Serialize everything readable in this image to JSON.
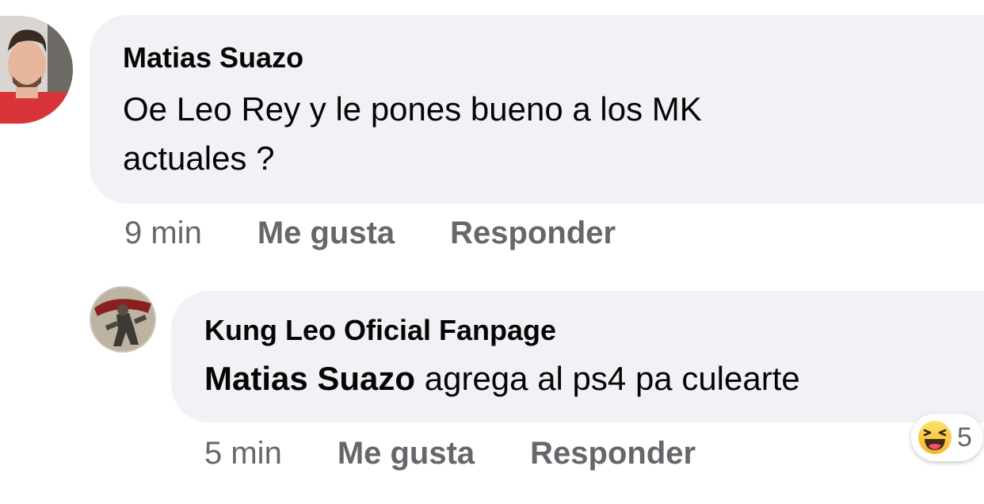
{
  "comments": [
    {
      "author": "Matias Suazo",
      "text_line1": "Oe Leo Rey y le pones bueno a los MK",
      "text_line2": "actuales ?",
      "time": "9 min",
      "like_label": "Me gusta",
      "reply_label": "Responder"
    },
    {
      "author": "Kung Leo Oficial Fanpage",
      "mention": "Matias Suazo",
      "text": " agrega al ps4 pa culearte",
      "time": "5 min",
      "like_label": "Me gusta",
      "reply_label": "Responder",
      "reaction": {
        "icon": "haha-emoji-icon",
        "count": "5"
      }
    }
  ],
  "colors": {
    "bubble": "#f0f2f5",
    "meta_text": "#65676b",
    "text": "#050505"
  }
}
